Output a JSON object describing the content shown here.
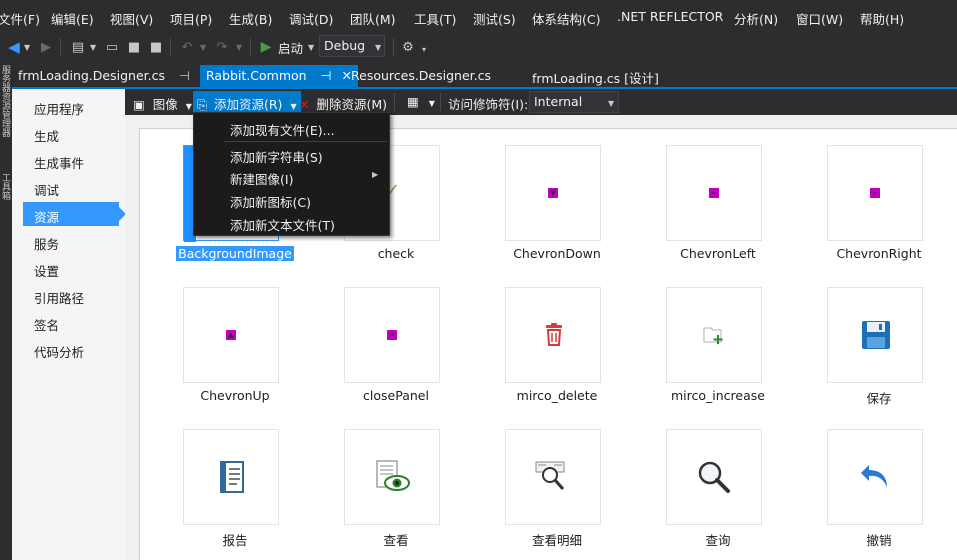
{
  "menubar": {
    "items": [
      "文件(F)",
      "编辑(E)",
      "视图(V)",
      "项目(P)",
      "生成(B)",
      "调试(D)",
      "团队(M)",
      "工具(T)",
      "测试(S)",
      "体系结构(C)",
      ".NET REFLECTOR",
      "分析(N)",
      "窗口(W)",
      "帮助(H)"
    ]
  },
  "toolbar": {
    "start_label": "启动",
    "config_value": "Debug"
  },
  "vstrip": {
    "labels": [
      "服务器资源管理器",
      "工具箱"
    ]
  },
  "doctabs": [
    {
      "label": "frmLoading.Designer.cs",
      "pin": "⊣"
    },
    {
      "label": "Rabbit.Common",
      "pin": "⊣",
      "close": "✕"
    },
    {
      "label": "Resources.Designer.cs"
    },
    {
      "label": "frmLoading.cs [设计]"
    }
  ],
  "nav": {
    "items": [
      "应用程序",
      "生成",
      "生成事件",
      "调试",
      "资源",
      "服务",
      "设置",
      "引用路径",
      "签名",
      "代码分析"
    ],
    "active_index": 4
  },
  "resource_toolbar": {
    "images_label": "图像",
    "add_label": "添加资源(R)",
    "remove_label": "删除资源(M)",
    "access_label": "访问修饰符(I):",
    "access_value": "Internal"
  },
  "dropdown": {
    "items": [
      "添加现有文件(E)...",
      "添加新字符串(S)",
      "新建图像(I)",
      "添加新图标(C)",
      "添加新文本文件(T)"
    ]
  },
  "resources": [
    {
      "name": "BackgroundImage",
      "icon": "background-image",
      "selected": true
    },
    {
      "name": "check",
      "icon": "check"
    },
    {
      "name": "ChevronDown",
      "icon": "chevron-down",
      "glyph": "▼"
    },
    {
      "name": "ChevronLeft",
      "icon": "chevron-left",
      "glyph": "«"
    },
    {
      "name": "ChevronRight",
      "icon": "chevron-right",
      "glyph": "»"
    },
    {
      "name": "ChevronUp",
      "icon": "chevron-up",
      "glyph": "▲"
    },
    {
      "name": "closePanel",
      "icon": "close-panel",
      "glyph": "✕"
    },
    {
      "name": "mirco_delete",
      "icon": "trash"
    },
    {
      "name": "mirco_increase",
      "icon": "folder-add"
    },
    {
      "name": "保存",
      "icon": "save"
    },
    {
      "name": "报告",
      "icon": "report"
    },
    {
      "name": "查看",
      "icon": "view"
    },
    {
      "name": "查看明细",
      "icon": "view-detail"
    },
    {
      "name": "查询",
      "icon": "search"
    },
    {
      "name": "撤销",
      "icon": "undo"
    }
  ],
  "colors": {
    "accent": "#007acc",
    "selection": "#3399ff",
    "chevron": "#c000c0"
  }
}
